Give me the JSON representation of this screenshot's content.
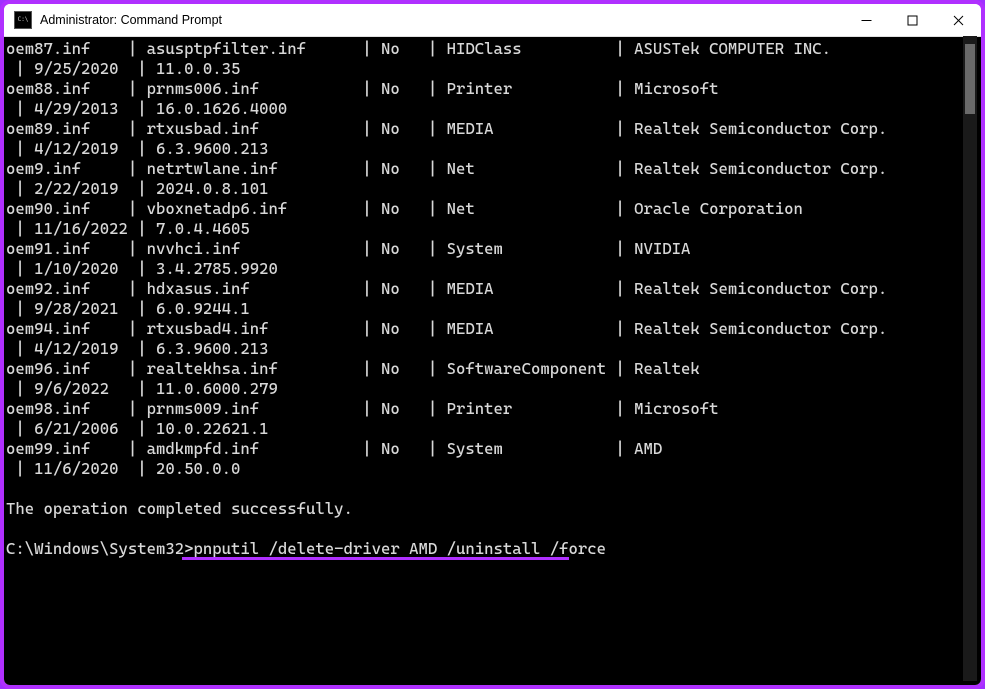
{
  "window": {
    "title": "Administrator: Command Prompt"
  },
  "columns": {
    "c1_width": 13,
    "c2_width": 23,
    "c3_width": 5,
    "c4_width": 18
  },
  "drivers": [
    {
      "inf": "oem87.inf",
      "orig": "asusptpfilter.inf",
      "signed": "No",
      "class": "HIDClass",
      "provider": "ASUSTek COMPUTER INC.",
      "date": "9/25/2020",
      "version": "11.0.0.35"
    },
    {
      "inf": "oem88.inf",
      "orig": "prnms006.inf",
      "signed": "No",
      "class": "Printer",
      "provider": "Microsoft",
      "date": "4/29/2013",
      "version": "16.0.1626.4000"
    },
    {
      "inf": "oem89.inf",
      "orig": "rtxusbad.inf",
      "signed": "No",
      "class": "MEDIA",
      "provider": "Realtek Semiconductor Corp.",
      "date": "4/12/2019",
      "version": "6.3.9600.213"
    },
    {
      "inf": "oem9.inf",
      "orig": "netrtwlane.inf",
      "signed": "No",
      "class": "Net",
      "provider": "Realtek Semiconductor Corp.",
      "date": "2/22/2019",
      "version": "2024.0.8.101"
    },
    {
      "inf": "oem90.inf",
      "orig": "vboxnetadp6.inf",
      "signed": "No",
      "class": "Net",
      "provider": "Oracle Corporation",
      "date": "11/16/2022",
      "version": "7.0.4.4605"
    },
    {
      "inf": "oem91.inf",
      "orig": "nvvhci.inf",
      "signed": "No",
      "class": "System",
      "provider": "NVIDIA",
      "date": "1/10/2020",
      "version": "3.4.2785.9920"
    },
    {
      "inf": "oem92.inf",
      "orig": "hdxasus.inf",
      "signed": "No",
      "class": "MEDIA",
      "provider": "Realtek Semiconductor Corp.",
      "date": "9/28/2021",
      "version": "6.0.9244.1"
    },
    {
      "inf": "oem94.inf",
      "orig": "rtxusbad4.inf",
      "signed": "No",
      "class": "MEDIA",
      "provider": "Realtek Semiconductor Corp.",
      "date": "4/12/2019",
      "version": "6.3.9600.213"
    },
    {
      "inf": "oem96.inf",
      "orig": "realtekhsa.inf",
      "signed": "No",
      "class": "SoftwareComponent",
      "provider": "Realtek",
      "date": "9/6/2022",
      "version": "11.0.6000.279"
    },
    {
      "inf": "oem98.inf",
      "orig": "prnms009.inf",
      "signed": "No",
      "class": "Printer",
      "provider": "Microsoft",
      "date": "6/21/2006",
      "version": "10.0.22621.1"
    },
    {
      "inf": "oem99.inf",
      "orig": "amdkmpfd.inf",
      "signed": "No",
      "class": "System",
      "provider": "AMD",
      "date": "11/6/2020",
      "version": "20.50.0.0"
    }
  ],
  "status_line": "The operation completed successfully.",
  "prompt": {
    "path": "C:\\Windows\\System32>",
    "command": "pnputil /delete-driver AMD /uninstall /force"
  },
  "accent_color": "#b030ff",
  "icons": {
    "app": "cmd-icon",
    "minimize": "minimize-icon",
    "maximize": "maximize-icon",
    "close": "close-icon"
  }
}
